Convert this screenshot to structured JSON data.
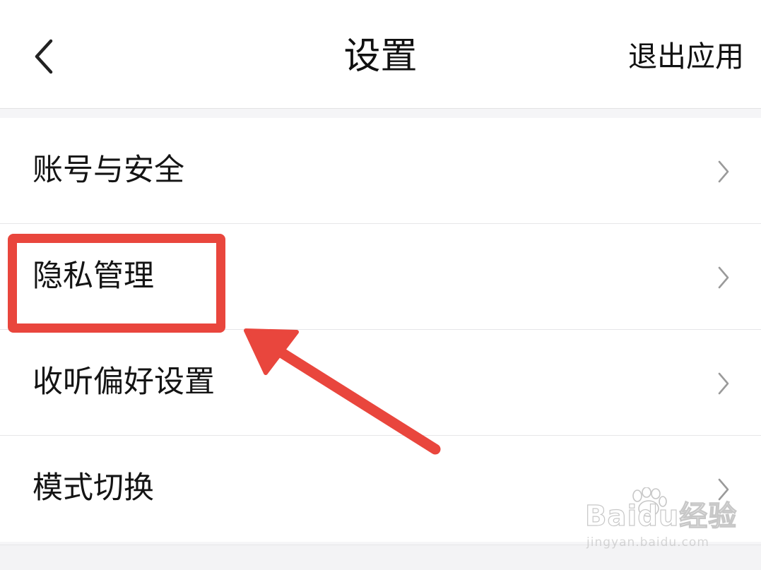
{
  "header": {
    "title": "设置",
    "exit_label": "退出应用",
    "back_icon": "chevron-left-icon"
  },
  "settings": {
    "items": [
      {
        "label": "账号与安全",
        "icon": "chevron-right-icon"
      },
      {
        "label": "隐私管理",
        "icon": "chevron-right-icon"
      },
      {
        "label": "收听偏好设置",
        "icon": "chevron-right-icon"
      },
      {
        "label": "模式切换",
        "icon": "chevron-right-icon"
      }
    ]
  },
  "annotation": {
    "color": "#e9463d"
  },
  "watermark": {
    "brand": "Baidu经验",
    "url": "jingyan.baidu.com"
  }
}
